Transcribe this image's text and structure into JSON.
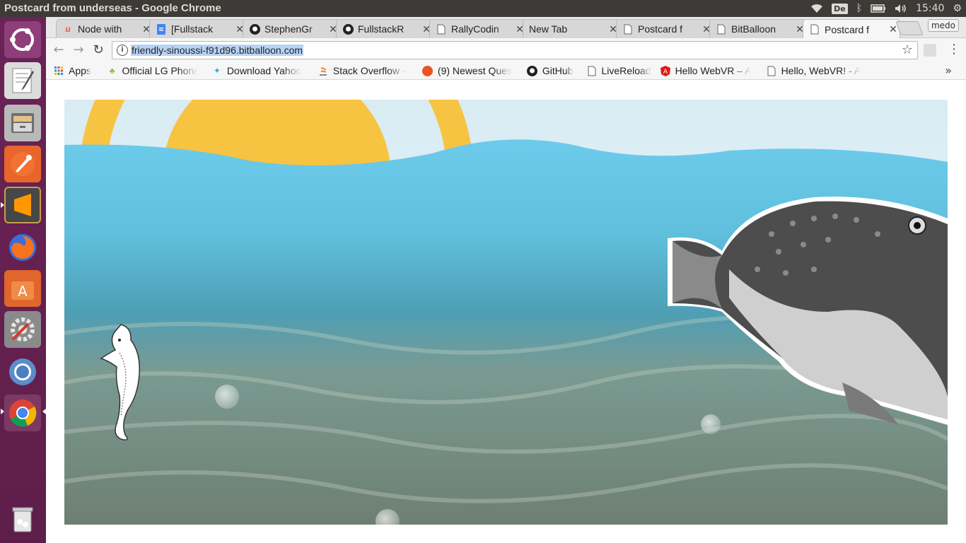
{
  "window": {
    "title": "Postcard from underseas - Google Chrome"
  },
  "panel": {
    "keyboard": "De",
    "clock": "15:40"
  },
  "tabs": [
    {
      "label": "Node with",
      "favicon": "udemy-icon",
      "color": "#ec5252"
    },
    {
      "label": "[Fullstack",
      "favicon": "docs-icon",
      "color": "#4285f4"
    },
    {
      "label": "StephenGr",
      "favicon": "github-icon",
      "color": "#222222"
    },
    {
      "label": "FullstackR",
      "favicon": "github-icon",
      "color": "#222222"
    },
    {
      "label": "RallyCodin",
      "favicon": "page-icon",
      "color": "#555555"
    },
    {
      "label": "New Tab",
      "favicon": "none",
      "color": "#555555"
    },
    {
      "label": "Postcard f",
      "favicon": "page-icon",
      "color": "#555555"
    },
    {
      "label": "BitBalloon",
      "favicon": "page-icon",
      "color": "#555555"
    },
    {
      "label": "Postcard f",
      "favicon": "page-icon",
      "color": "#555555",
      "active": true
    }
  ],
  "tab_close": "✕",
  "profile": "medo",
  "address": {
    "url": "friendly-sinoussi-f91d96.bitballoon.com"
  },
  "bookmarks": [
    {
      "label": "Apps",
      "icon": "apps-grid-icon"
    },
    {
      "label": "Official LG Phone",
      "icon": "android-icon"
    },
    {
      "label": "Download Yahoo",
      "icon": "yahoo-icon"
    },
    {
      "label": "Stack Overflow -",
      "icon": "stackoverflow-icon"
    },
    {
      "label": "(9) Newest Ques",
      "icon": "ask-icon"
    },
    {
      "label": "GitHub",
      "icon": "github-icon"
    },
    {
      "label": "LiveReload",
      "icon": "page-icon"
    },
    {
      "label": "Hello WebVR – A",
      "icon": "angular-icon"
    },
    {
      "label": "Hello, WebVR! - A",
      "icon": "page-icon"
    }
  ],
  "bookmarks_more": "»",
  "colors": {
    "sun": "#f6c441",
    "water": "#6ccbea",
    "sand": "#8b9c86"
  }
}
